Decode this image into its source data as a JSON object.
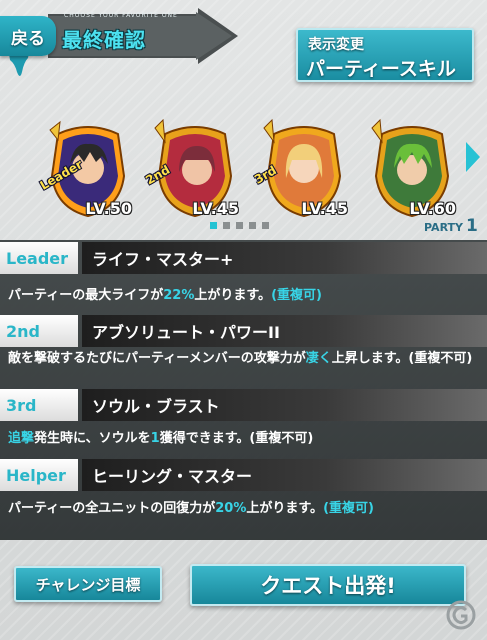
{
  "header": {
    "back_label": "戻る",
    "title_sub": "CHOOSE YOUR FAVORITE ONE",
    "title": "最終確認",
    "display_change": {
      "line1": "表示変更",
      "line2": "パーティースキル"
    }
  },
  "party": {
    "units": [
      {
        "rank": "Leader",
        "level": "LV.50",
        "hair": "#2a2a2a",
        "frame": "#ff9f1a"
      },
      {
        "rank": "2nd",
        "level": "LV.45",
        "hair": "#7c2d3b",
        "frame": "#e8a21b"
      },
      {
        "rank": "3rd",
        "level": "LV.45",
        "hair": "#f2cf7a",
        "frame": "#f0a81d"
      },
      {
        "rank": "",
        "level": "LV.60",
        "hair": "#6abf3a",
        "frame": "#e6a21b"
      }
    ],
    "pager": {
      "total": 5,
      "active": 0
    },
    "party_label": "PARTY",
    "party_number": "1"
  },
  "skills": [
    {
      "tag": "Leader",
      "name": "ライフ・マスター+",
      "desc_parts": [
        {
          "t": "パーティーの最大ライフが"
        },
        {
          "t": "22%",
          "hl": true
        },
        {
          "t": "上がります。"
        },
        {
          "t": "(重複可)",
          "hl": true
        }
      ]
    },
    {
      "tag": "2nd",
      "name": "アブソリュート・パワーII",
      "desc_parts": [
        {
          "t": "敵を撃破するたびにパーティーメンバーの攻撃力が"
        },
        {
          "t": "凄く",
          "hl": true
        },
        {
          "t": "上昇します。(重複不可)"
        }
      ]
    },
    {
      "tag": "3rd",
      "name": "ソウル・ブラスト",
      "desc_parts": [
        {
          "t": "追撃",
          "hl": true
        },
        {
          "t": "発生時に、ソウルを"
        },
        {
          "t": "1",
          "hl": true
        },
        {
          "t": "獲得できます。(重複不可)"
        }
      ]
    },
    {
      "tag": "Helper",
      "name": "ヒーリング・マスター",
      "desc_parts": [
        {
          "t": "パーティーの全ユニットの回復力が"
        },
        {
          "t": "20%",
          "hl": true
        },
        {
          "t": "上がります。"
        },
        {
          "t": "(重複可)",
          "hl": true
        }
      ]
    }
  ],
  "buttons": {
    "challenge": "チャレンジ目標",
    "quest_start": "クエスト出発!"
  },
  "colors": {
    "accent": "#2ab6c8",
    "highlight": "#38d4e6",
    "panel": "#3a4041"
  }
}
